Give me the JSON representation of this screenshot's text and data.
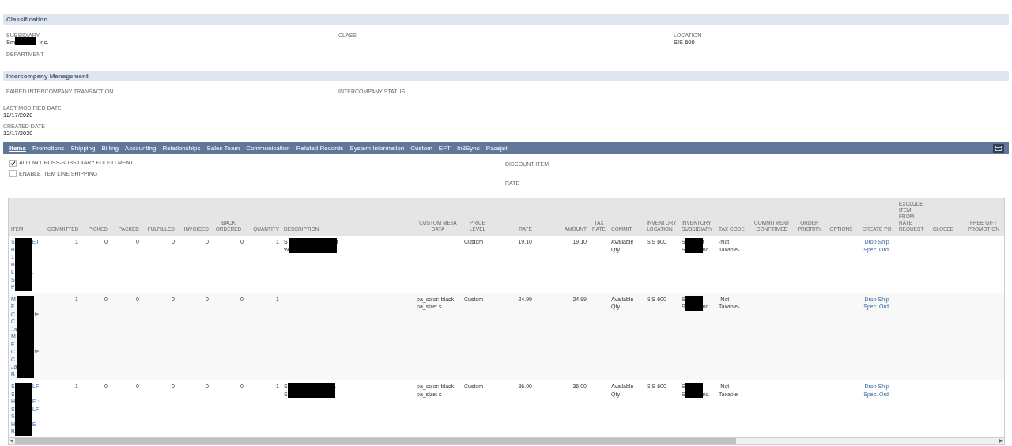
{
  "classification": {
    "title": "Classification",
    "fields": [
      {
        "label": "SUBSIDIARY",
        "value": {
          "start": "Sm",
          "end": "Inc."
        }
      },
      {
        "label": "CLASS"
      },
      {
        "label": "LOCATION",
        "value": {
          "start": "SIS 600"
        }
      },
      {
        "label": "DEPARTMENT"
      }
    ]
  },
  "intercompany": {
    "title": "Intercompany Management",
    "fields": [
      {
        "label": "PAIRED INTERCOMPANY TRANSACTION"
      },
      {
        "label": "INTERCOMPANY STATUS"
      }
    ]
  },
  "dates": [
    {
      "label": "LAST MODIFIED DATE",
      "value": "12/17/2020"
    },
    {
      "label": "CREATED DATE",
      "value": "12/17/2020"
    }
  ],
  "tabs": [
    {
      "label": "Items",
      "selected": true
    },
    {
      "label": "Promotions",
      "selected": false
    },
    {
      "label": "Shipping",
      "selected": false
    },
    {
      "label": "Billing",
      "selected": false
    },
    {
      "label": "Accounting",
      "selected": false
    },
    {
      "label": "Relationships",
      "selected": false
    },
    {
      "label": "Sales Team",
      "selected": false
    },
    {
      "label": "Communication",
      "selected": false
    },
    {
      "label": "Related Records",
      "selected": false
    },
    {
      "label": "System Information",
      "selected": false
    },
    {
      "label": "Custom",
      "selected": false
    },
    {
      "label": "EFT",
      "selected": false
    },
    {
      "label": "In8Sync",
      "selected": false
    },
    {
      "label": "Pacejet",
      "selected": false
    }
  ],
  "options": [
    {
      "label": "ALLOW CROSS-SUBSIDIARY FULFILLMENT",
      "checked": true
    },
    {
      "label": "ENABLE ITEM LINE SHIPPING",
      "checked": false
    }
  ],
  "discount": [
    {
      "label": "DISCOUNT ITEM"
    },
    {
      "label": "RATE"
    }
  ],
  "table": {
    "columns": [
      "ITEM",
      "COMMITTED",
      "PICKED",
      "PACKED",
      "FULFILLED",
      "INVOICED",
      "BACK ORDERED",
      "QUANTITY",
      "DESCRIPTION",
      "CUSTOM META DATA",
      "PRICE LEVEL",
      "RATE",
      "AMOUNT",
      "TAX RATE",
      "COMMIT",
      "INVENTORY LOCATION",
      "INVENTORY SUBSIDIARY",
      "TAX CODE",
      "COMMITMENT CONFIRMED",
      "ORDER PRIORITY",
      "OPTIONS",
      "CREATE PO",
      "EXCLUDE ITEM FROM RATE REQUEST",
      "CLOSED",
      "FREE GIFT PROMOTION"
    ],
    "rows": [
      {
        "cells": [
          {
            "kind": "redacted",
            "link": true,
            "lines": [
              {
                "start": "S",
                "end": "ET"
              },
              {
                "start": "B"
              },
              {
                "start": "1"
              },
              {
                "start": "B"
              },
              {
                "start": "L",
                "end": "."
              },
              {
                "start": "S"
              },
              {
                "start": "P"
              }
            ]
          },
          "1",
          "0",
          "0",
          "0",
          "0",
          "0",
          "1",
          {
            "kind": "redacted",
            "link": false,
            "lines": [
              {
                "start": "S",
                "end": "t"
              },
              {
                "start": "W"
              }
            ]
          },
          "",
          "Custom",
          "19.10",
          "19.10",
          "",
          "Available Qty",
          "SIS 600",
          {
            "kind": "redacted",
            "link": false,
            "lines": [
              {
                "start": "S",
                "end": "t"
              },
              {
                "start": "S",
                "end": "nc."
              }
            ]
          },
          "-Not Taxable-",
          "",
          "",
          "",
          {
            "kind": "link",
            "text": "Drop Ship Spec. Ord."
          },
          "",
          "",
          ""
        ]
      },
      {
        "cells": [
          {
            "kind": "redacted",
            "link": true,
            "lines": [
              {
                "start": "M"
              },
              {
                "start": "E"
              },
              {
                "start": "C",
                "end": "te"
              },
              {
                "start": "C"
              },
              {
                "start": "Ja"
              },
              {
                "start": "M"
              },
              {
                "start": "E"
              },
              {
                "start": "C",
                "end": "te"
              },
              {
                "start": "C"
              },
              {
                "start": "Ja"
              },
              {
                "start": "B"
              }
            ]
          },
          "1",
          "0",
          "0",
          "0",
          "0",
          "0",
          "1",
          "",
          "pa_color: black\npa_size: s",
          "Custom",
          "24.99",
          "24.99",
          "",
          "Available Qty",
          "SIS 600",
          {
            "kind": "redacted",
            "link": false,
            "lines": [
              {
                "start": "S"
              },
              {
                "start": "S",
                "end": "nc."
              }
            ]
          },
          "-Not Taxable-",
          "",
          "",
          "",
          {
            "kind": "link",
            "text": "Drop Ship Spec. Ord."
          },
          "",
          "",
          ""
        ]
      },
      {
        "cells": [
          {
            "kind": "redacted",
            "link": true,
            "lines": [
              {
                "start": "S",
                "end": "LF"
              },
              {
                "start": "S"
              },
              {
                "start": "H",
                "end": "E :"
              },
              {
                "start": "S",
                "end": "LF"
              },
              {
                "start": "S"
              },
              {
                "start": "H",
                "end": "E"
              },
              {
                "start": "B"
              }
            ]
          },
          "1",
          "0",
          "0",
          "0",
          "0",
          "0",
          "1",
          {
            "kind": "redacted",
            "link": false,
            "lines": [
              {
                "start": "S",
                "end": "."
              },
              {
                "start": "S"
              }
            ]
          },
          "pa_color: black\npa_size: s",
          "Custom",
          "36.00",
          "36.00",
          "",
          "Available Qty",
          "SIS 600",
          {
            "kind": "redacted",
            "link": false,
            "lines": [
              {
                "start": "S"
              },
              {
                "start": "S",
                "end": "nc."
              }
            ]
          },
          "-Not Taxable-",
          "",
          "",
          "",
          {
            "kind": "link",
            "text": "Drop Ship Spec. Ord."
          },
          "",
          "",
          ""
        ]
      }
    ]
  }
}
